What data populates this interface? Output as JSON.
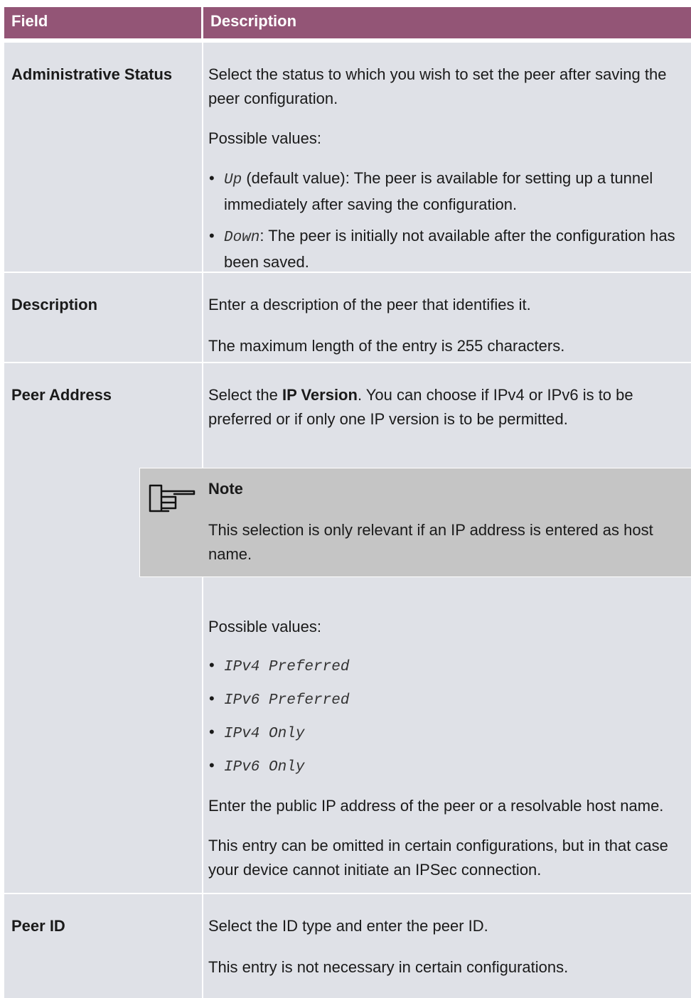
{
  "header": {
    "field": "Field",
    "description": "Description"
  },
  "rows": [
    {
      "field": "Administrative Status",
      "p1": "Select the status to which you wish to set the peer after saving the peer configuration.",
      "p2": "Possible values:",
      "items": [
        {
          "code": "Up",
          "text": " (default value): The peer is available for setting up a tunnel immediately after saving the configuration."
        },
        {
          "code": "Down",
          "text": ": The peer is initially not available after the configuration has been saved."
        }
      ]
    },
    {
      "field": "Description",
      "p1": "Enter a description of the peer that identifies it.",
      "p2": "The maximum length of the entry is 255 characters."
    },
    {
      "field": "Peer Address",
      "p1_pre": "Select the ",
      "p1_bold": "IP Version",
      "p1_post": ". You can choose if IPv4 or IPv6 is to be preferred or if only one IP version is to be permitted.",
      "note_title": "Note",
      "note_text": "This selection is only relevant if an IP address is entered as host name.",
      "p2": "Possible values:",
      "items": [
        "IPv4 Preferred",
        "IPv6 Preferred",
        "IPv4 Only",
        "IPv6 Only"
      ],
      "p3": "Enter the public IP address of the peer or a resolvable host name.",
      "p4": "This entry can be omitted in certain configurations, but in that case your device cannot initiate an IPSec connection."
    },
    {
      "field": "Peer ID",
      "p1": "Select the ID type and enter the peer ID.",
      "p2": "This entry is not necessary in certain configurations."
    }
  ],
  "icons": {
    "note": "pointing-hand-icon"
  },
  "colors": {
    "header_bg": "#935576",
    "row_bg": "#dfe1e7",
    "note_bg": "#c5c5c5"
  }
}
